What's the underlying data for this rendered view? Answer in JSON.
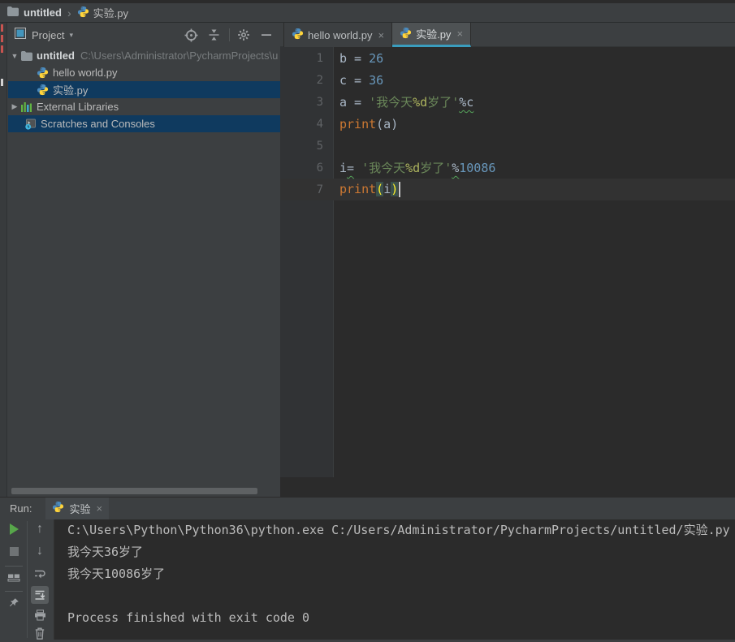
{
  "breadcrumbs": {
    "project": "untitled",
    "separator": "›",
    "file": "实验.py"
  },
  "project_panel": {
    "title": "Project",
    "title_caret": "▾",
    "header_icons": [
      {
        "name": "locate-icon"
      },
      {
        "name": "collapse-all-icon"
      },
      {
        "name": "separator"
      },
      {
        "name": "settings-gear-icon"
      },
      {
        "name": "hide-panel-icon"
      }
    ],
    "tree": [
      {
        "name": "tree-item-untitled",
        "icon": "folder",
        "arrow": "down",
        "label": "untitled",
        "bold": true,
        "path": "C:\\Users\\Administrator\\PycharmProjects\\u",
        "indent": 2,
        "selected": false
      },
      {
        "name": "tree-item-hello-world-py",
        "icon": "python",
        "label": "hello world.py",
        "indent": 34,
        "selected": false
      },
      {
        "name": "tree-item-shiyan-py",
        "icon": "python",
        "label": "实验.py",
        "indent": 34,
        "selected": true
      },
      {
        "name": "tree-item-external-libraries",
        "icon": "libraries",
        "arrow": "right",
        "label": "External Libraries",
        "indent": 2,
        "selected": false
      },
      {
        "name": "tree-item-scratches-and-consoles",
        "icon": "scratches",
        "label": "Scratches and Consoles",
        "indent": 19,
        "selected": true
      }
    ]
  },
  "editor": {
    "tabs": [
      {
        "name": "tab-hello-world-py",
        "label": "hello world.py",
        "close": "×",
        "active": false
      },
      {
        "name": "tab-shiyan-py",
        "label": "实验.py",
        "close": "×",
        "active": true
      }
    ],
    "lines": [
      {
        "num": "1",
        "tokens": [
          {
            "t": "b = ",
            "c": "plain"
          },
          {
            "t": "26",
            "c": "number"
          }
        ]
      },
      {
        "num": "2",
        "tokens": [
          {
            "t": "c = ",
            "c": "plain"
          },
          {
            "t": "36",
            "c": "number"
          }
        ]
      },
      {
        "num": "3",
        "tokens": [
          {
            "t": "a = ",
            "c": "plain"
          },
          {
            "t": "'我今天",
            "c": "string"
          },
          {
            "t": "%d",
            "c": "format"
          },
          {
            "t": "岁了'",
            "c": "string"
          },
          {
            "t": "%c",
            "c": "plain",
            "wavy": true
          }
        ]
      },
      {
        "num": "4",
        "tokens": [
          {
            "t": "print",
            "c": "keyword"
          },
          {
            "t": "(a)",
            "c": "plain"
          }
        ]
      },
      {
        "num": "5",
        "tokens": []
      },
      {
        "num": "6",
        "tokens": [
          {
            "t": "i",
            "c": "plain"
          },
          {
            "t": "=",
            "c": "plain",
            "wavy": true
          },
          {
            "t": " ",
            "c": "plain"
          },
          {
            "t": "'我今天",
            "c": "string"
          },
          {
            "t": "%d",
            "c": "format"
          },
          {
            "t": "岁了'",
            "c": "string"
          },
          {
            "t": "%",
            "c": "plain",
            "wavy": true
          },
          {
            "t": "10086",
            "c": "number"
          }
        ]
      },
      {
        "num": "7",
        "caret": true,
        "tokens": [
          {
            "t": "print",
            "c": "keyword"
          },
          {
            "t": "(",
            "c": "plain",
            "brace": true
          },
          {
            "t": "i",
            "c": "plain"
          },
          {
            "t": ")",
            "c": "plain",
            "brace": true
          },
          {
            "t": "",
            "c": "plain",
            "cursor": true
          }
        ]
      }
    ]
  },
  "run_panel": {
    "label": "Run:",
    "tab": {
      "label": "实验",
      "close": "×"
    },
    "toolbar_col1": [
      "rerun",
      "stop",
      "restore-layout",
      "pin"
    ],
    "toolbar_col2": [
      "up",
      "down",
      "soft-wrap",
      "scroll-to-end",
      "print",
      "clear"
    ],
    "console": [
      "C:\\Users\\Python\\Python36\\python.exe C:/Users/Administrator/PycharmProjects/untitled/实验.py",
      "我今天36岁了",
      "我今天10086岁了",
      "",
      "Process finished with exit code 0"
    ]
  },
  "colors": {
    "panel_bg": "#3C3F41",
    "editor_bg": "#2B2B2B",
    "selection_bg": "#0F3A5F",
    "active_tab_underline": "#3A9DBE",
    "caret_line_bg": "#323232",
    "string": "#6A8759",
    "number": "#6897BB",
    "keyword": "#CC7832",
    "plain_text": "#A9B7C6",
    "format_spec": "#ADB55E",
    "line_number": "#606366",
    "console_text": "#BBBBBB",
    "run_green": "#57A64A",
    "error_stripe_red": "#C75450",
    "brace_match_bg": "#3B514D",
    "brace_match_fg": "#FFEF28"
  }
}
